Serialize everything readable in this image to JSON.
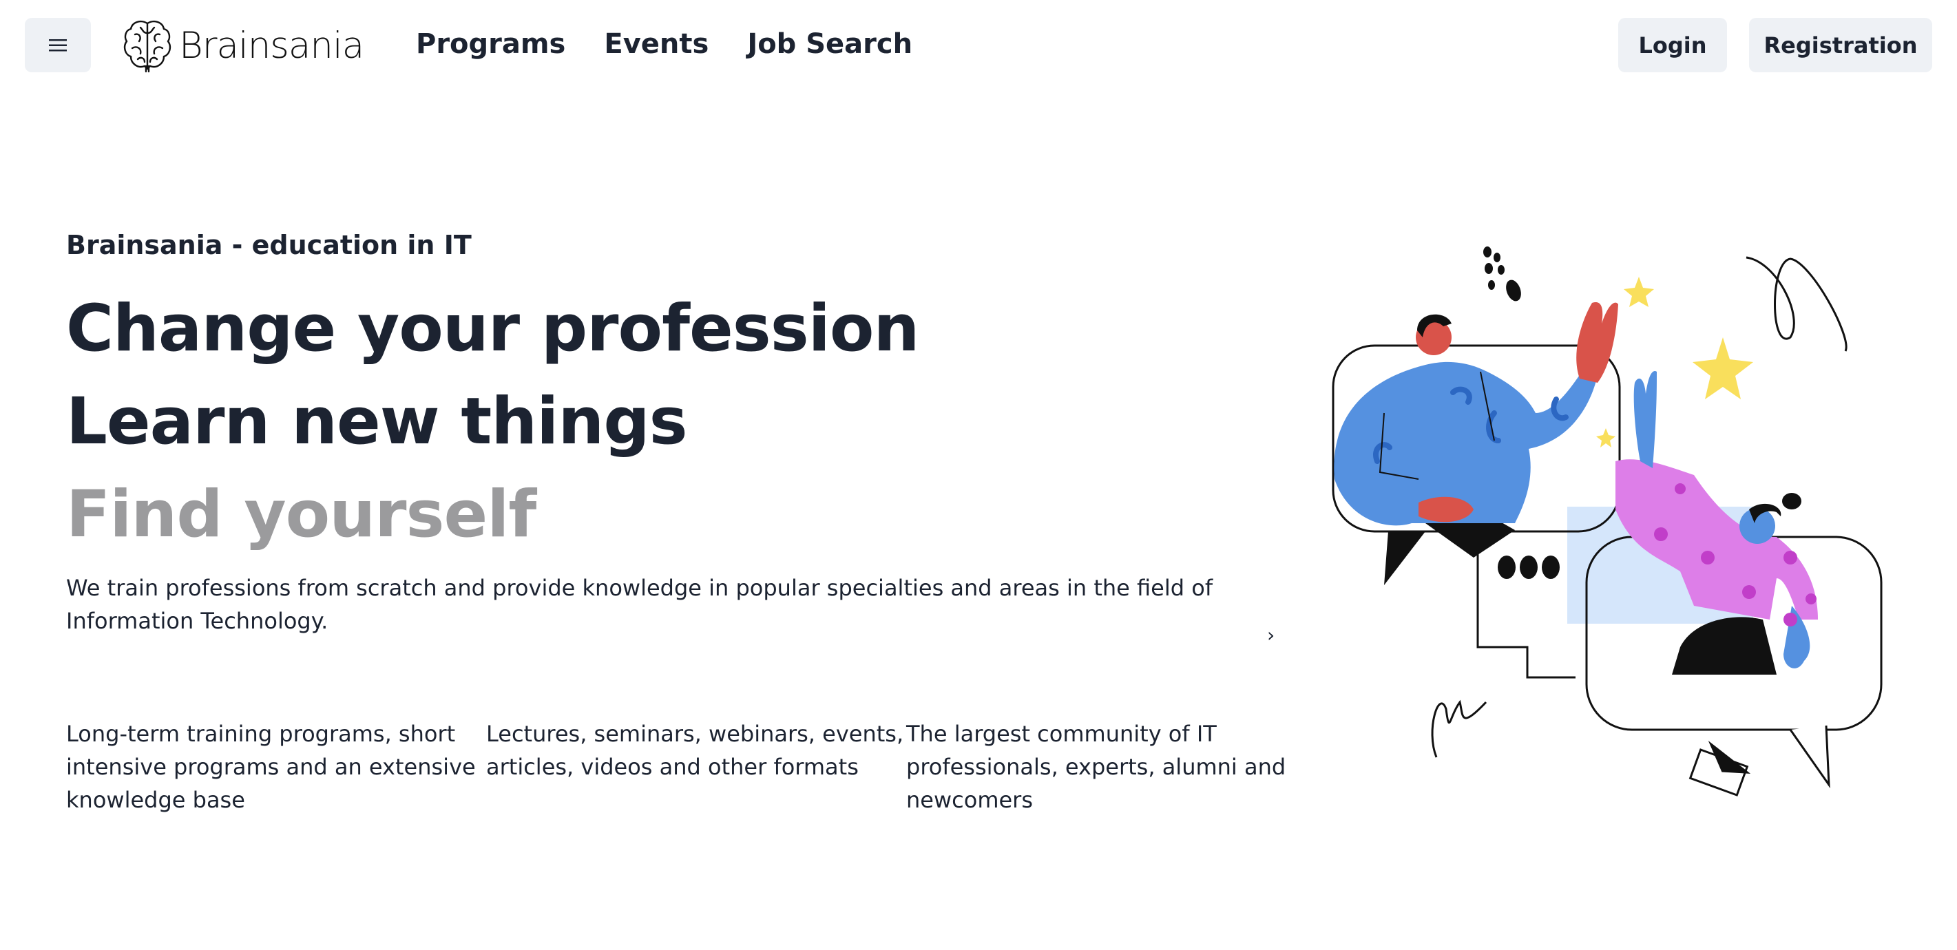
{
  "header": {
    "logo_text": "Brainsania",
    "nav": [
      "Programs",
      "Events",
      "Job Search"
    ],
    "login": "Login",
    "registration": "Registration"
  },
  "hero": {
    "eyebrow": "Brainsania - education in IT",
    "headlines": [
      "Change your profession",
      "Learn new things",
      "Find yourself"
    ],
    "lead": "We train professions from scratch and provide knowledge in popular specialties and areas in the field of Information Technology.",
    "carousel_arrow": "›",
    "features": [
      "Long-term training programs, short intensive programs and an extensive knowledge base",
      "Lectures, seminars, webinars, events, articles, videos and other formats",
      "The largest community of IT professionals, experts, alumni and newcomers"
    ]
  },
  "colors": {
    "button_bg": "#eef1f5",
    "text": "#1c2331",
    "muted": "#9b9b9d",
    "illus_blue": "#5591e0",
    "illus_red": "#d9534a",
    "illus_pink": "#dd7ee8",
    "illus_yellow": "#f9df5c",
    "illus_lightblue": "#d5e6fb"
  }
}
